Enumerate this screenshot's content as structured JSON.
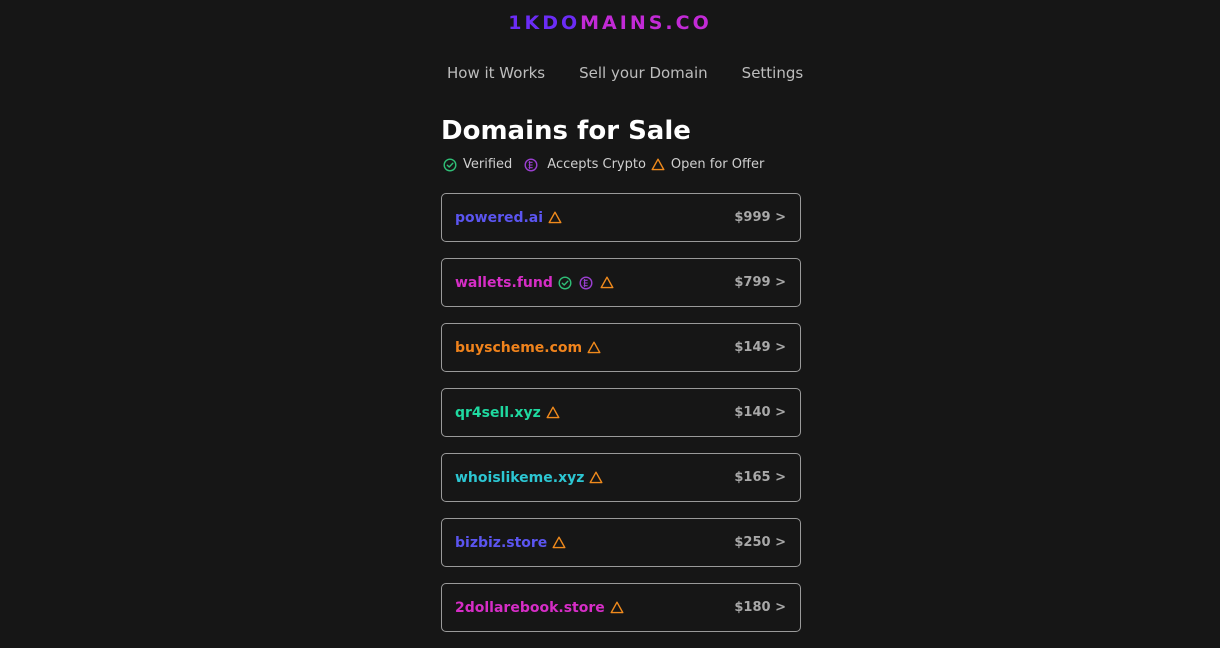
{
  "logo": {
    "part1": "1KDO",
    "part2": "MAINS.CO"
  },
  "nav": {
    "how_it_works": "How it Works",
    "sell_domain": "Sell your Domain",
    "settings": "Settings"
  },
  "page_title": "Domains for Sale",
  "legend": {
    "verified": "Verified",
    "accepts_crypto": "Accepts Crypto",
    "open_for_offer": "Open for Offer"
  },
  "colors": {
    "verified": "#2fbf77",
    "crypto": "#9b3fd1",
    "offer": "#f08a1c"
  },
  "domains": [
    {
      "name": "powered.ai",
      "price": "$999 >",
      "color": "#5b55f0",
      "verified": false,
      "crypto": false,
      "offer": true
    },
    {
      "name": "wallets.fund",
      "price": "$799 >",
      "color": "#d62dc6",
      "verified": true,
      "crypto": true,
      "offer": true
    },
    {
      "name": "buyscheme.com",
      "price": "$149 >",
      "color": "#f0831c",
      "verified": false,
      "crypto": false,
      "offer": true
    },
    {
      "name": "qr4sell.xyz",
      "price": "$140 >",
      "color": "#1fd9a0",
      "verified": false,
      "crypto": false,
      "offer": true
    },
    {
      "name": "whoislikeme.xyz",
      "price": "$165 >",
      "color": "#2cc6d2",
      "verified": false,
      "crypto": false,
      "offer": true
    },
    {
      "name": "bizbiz.store",
      "price": "$250 >",
      "color": "#5b55f0",
      "verified": false,
      "crypto": false,
      "offer": true
    },
    {
      "name": "2dollarebook.store",
      "price": "$180 >",
      "color": "#d62dc6",
      "verified": false,
      "crypto": false,
      "offer": true
    }
  ]
}
